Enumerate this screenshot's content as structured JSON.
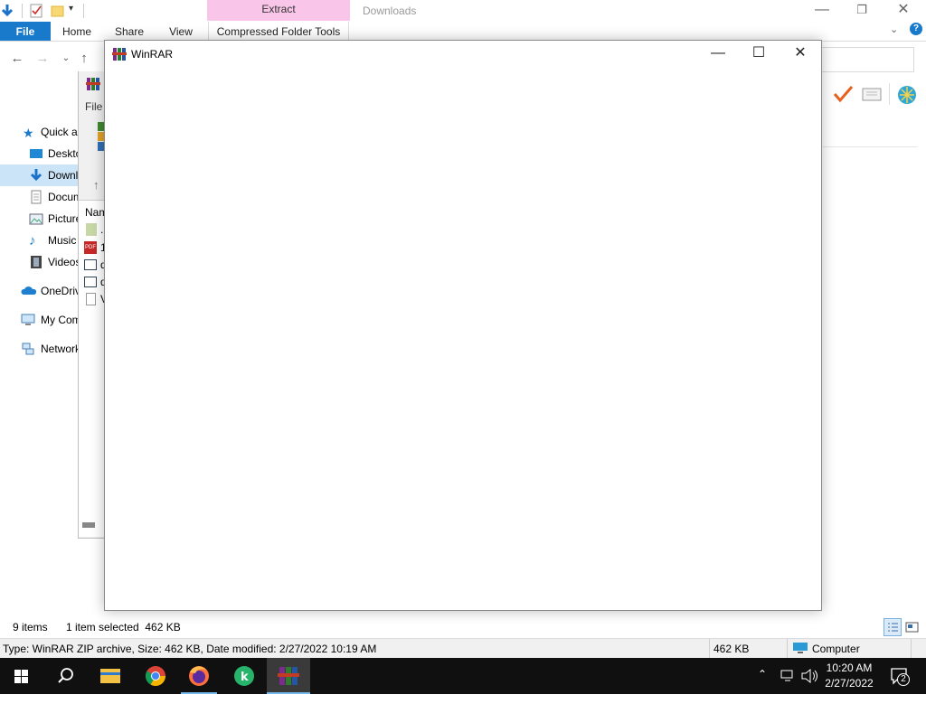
{
  "explorer": {
    "title": "Downloads",
    "context_tab_group": "Extract",
    "ribbon_tabs": [
      "File",
      "Home",
      "Share",
      "View",
      "Compressed Folder Tools"
    ],
    "sidebar": [
      {
        "label": "Quick access",
        "icon": "star-icon"
      },
      {
        "label": "Desktop",
        "icon": "desktop-icon"
      },
      {
        "label": "Downloads",
        "icon": "download-icon",
        "selected": true
      },
      {
        "label": "Documents",
        "icon": "document-icon"
      },
      {
        "label": "Pictures",
        "icon": "pictures-icon"
      },
      {
        "label": "Music",
        "icon": "music-icon"
      },
      {
        "label": "Videos",
        "icon": "video-icon"
      },
      {
        "label": "OneDrive",
        "icon": "cloud-icon"
      },
      {
        "label": "My Computer",
        "icon": "computer-icon"
      },
      {
        "label": "Network",
        "icon": "network-icon"
      }
    ],
    "status": {
      "item_count": "9 items",
      "selection": "1 item selected  462 KB"
    },
    "details": {
      "description": "Type: WinRAR ZIP archive, Size: 462 KB, Date modified: 2/27/2022 10:19 AM",
      "size": "462 KB",
      "location": "Computer"
    }
  },
  "winrar_back": {
    "menu_fragment": "File",
    "column_fragment": "Nam",
    "rows": [
      "..",
      "1",
      "d",
      "d",
      "V"
    ]
  },
  "winrar_dialog": {
    "title": "WinRAR",
    "controls": {
      "minimize": "—",
      "maximize": "☐",
      "close": "✕"
    }
  },
  "taskbar": {
    "apps": [
      "start-icon",
      "search-icon",
      "file-explorer-icon",
      "chrome-icon",
      "firefox-icon",
      "kaspersky-icon",
      "winrar-icon"
    ],
    "clock": {
      "time": "10:20 AM",
      "date": "2/27/2022"
    },
    "notification_count": "2"
  },
  "colors": {
    "accent": "#1979ca",
    "context_tab": "#f9c5e8",
    "selection": "#cce4f7",
    "taskbar": "#101010"
  }
}
